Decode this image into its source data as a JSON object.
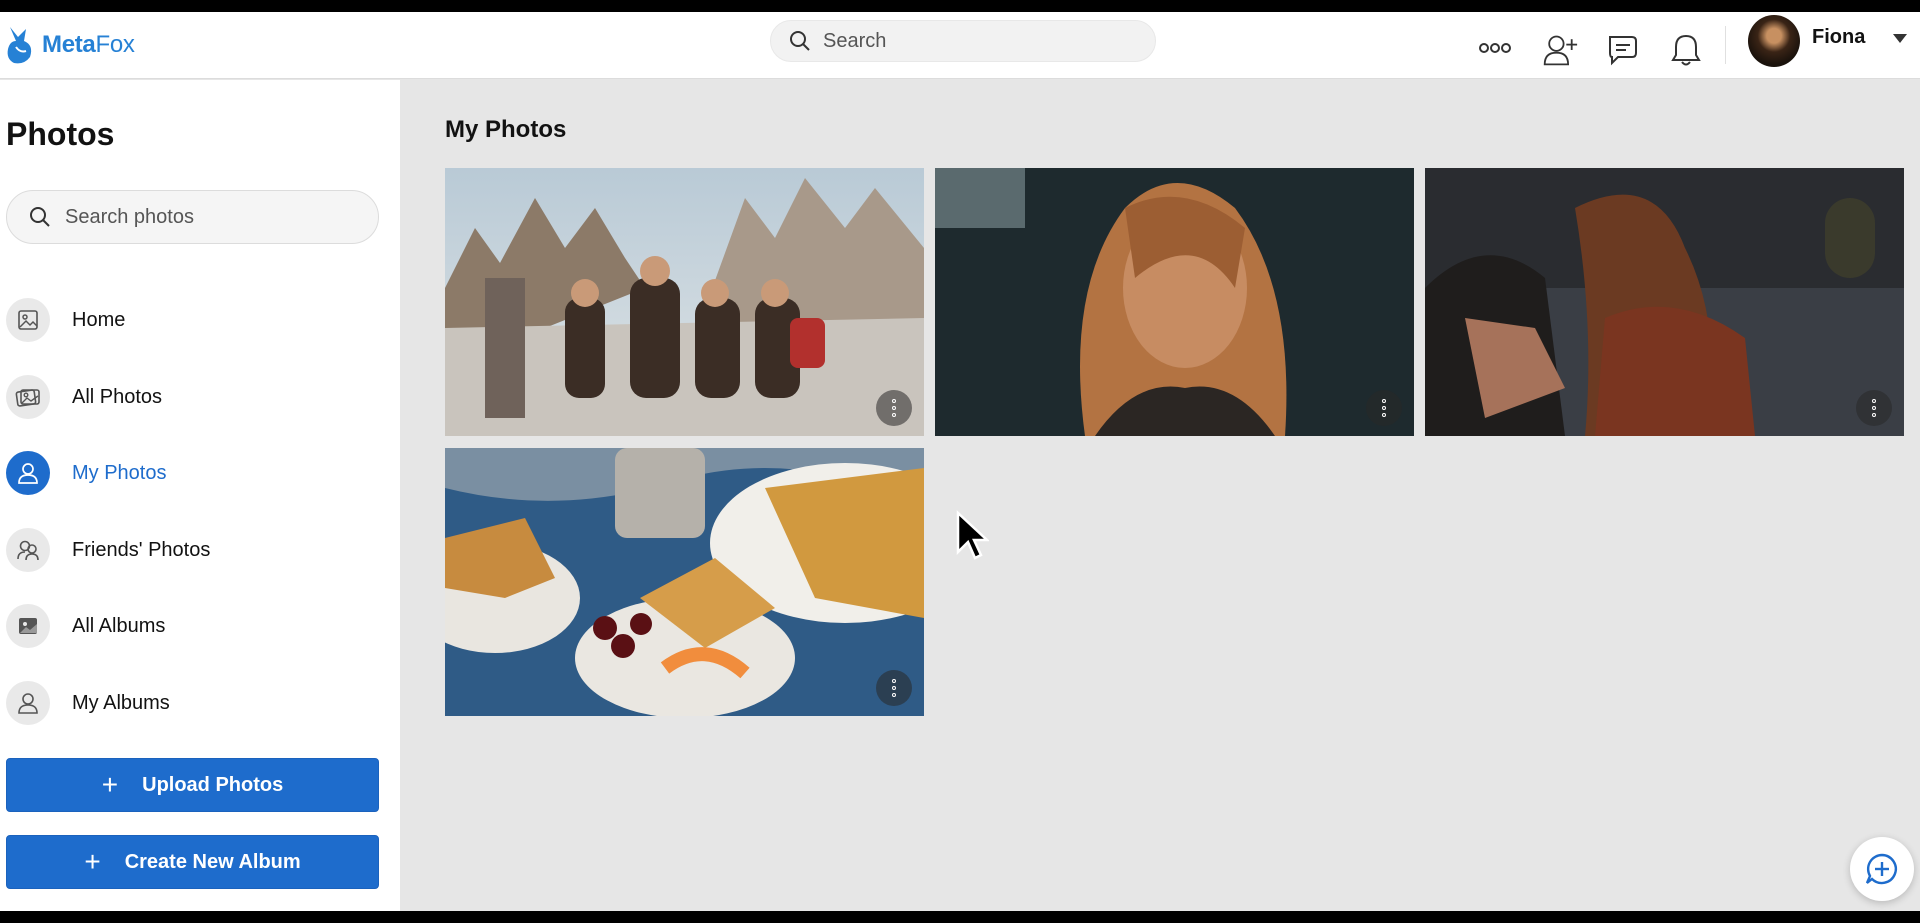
{
  "brand": {
    "name_bold": "Meta",
    "name_light": "Fox"
  },
  "header": {
    "search_placeholder": "Search",
    "user_name": "Fiona",
    "icons": [
      "more-icon",
      "add-friend-icon",
      "chat-icon",
      "notification-bell-icon",
      "user-avatar",
      "caret-down-icon"
    ]
  },
  "sidebar": {
    "title": "Photos",
    "search_placeholder": "Search photos",
    "items": [
      {
        "label": "Home",
        "icon": "photo-icon"
      },
      {
        "label": "All Photos",
        "icon": "photos-stack-icon"
      },
      {
        "label": "My Photos",
        "icon": "user-icon",
        "active": true
      },
      {
        "label": "Friends' Photos",
        "icon": "friends-icon"
      },
      {
        "label": "All Albums",
        "icon": "album-icon"
      },
      {
        "label": "My Albums",
        "icon": "user-icon"
      }
    ],
    "upload_label": "Upload Photos",
    "create_album_label": "Create New Album"
  },
  "main": {
    "title": "My Photos",
    "photos": [
      {
        "subject": "hikers-in-mountains"
      },
      {
        "subject": "woman-portrait-sunlight"
      },
      {
        "subject": "woman-outdoors-dusk"
      },
      {
        "subject": "cake-slices-and-cherries"
      }
    ]
  },
  "colors": {
    "accent": "#1e6ccc",
    "logo": "#2681d5",
    "page_bg": "#e6e6e6"
  }
}
